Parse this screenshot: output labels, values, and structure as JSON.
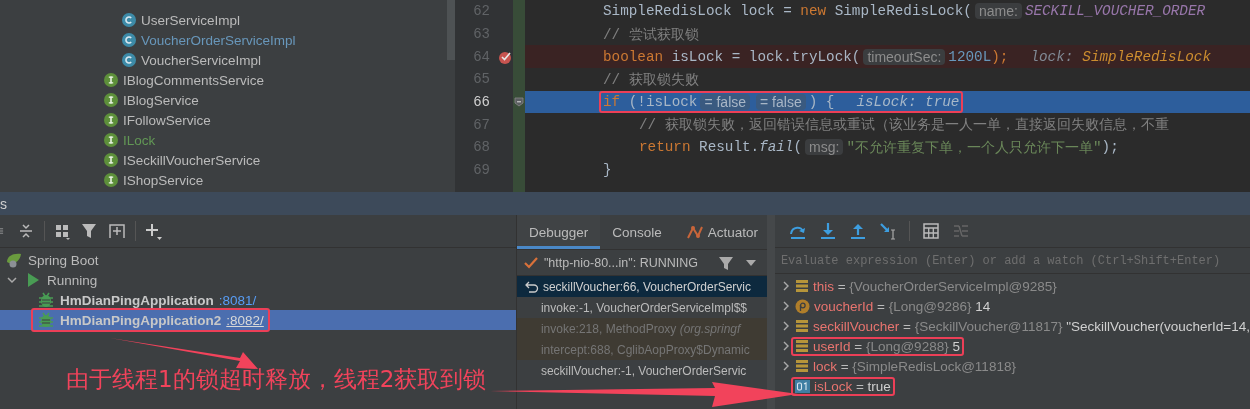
{
  "project_tree": {
    "items": [
      {
        "kind": "class",
        "label": "UserServiceImpl",
        "color": "#bbbbbb"
      },
      {
        "kind": "class",
        "label": "VoucherOrderServiceImpl",
        "color": "#6897bb"
      },
      {
        "kind": "class",
        "label": "VoucherServiceImpl",
        "color": "#bbbbbb"
      },
      {
        "kind": "interface",
        "label": "IBlogCommentsService",
        "color": "#bbbbbb"
      },
      {
        "kind": "interface",
        "label": "IBlogService",
        "color": "#bbbbbb"
      },
      {
        "kind": "interface",
        "label": "IFollowService",
        "color": "#bbbbbb"
      },
      {
        "kind": "interface",
        "label": "ILock",
        "color": "#629755"
      },
      {
        "kind": "interface",
        "label": "ISeckillVoucherService",
        "color": "#bbbbbb"
      },
      {
        "kind": "interface",
        "label": "IShopService",
        "color": "#bbbbbb"
      }
    ]
  },
  "editor": {
    "lines": [
      {
        "number": "62",
        "breakpoint": false,
        "current": false,
        "highlighted": false,
        "tokens": [
          {
            "kind": "plain",
            "text": "SimpleRedisLock lock = "
          },
          {
            "kind": "keyword",
            "text": "new"
          },
          {
            "kind": "plain",
            "text": " SimpleRedisLock("
          },
          {
            "kind": "hint",
            "text": "name:"
          },
          {
            "kind": "const",
            "text": "SECKILL_VOUCHER_ORDER"
          }
        ]
      },
      {
        "number": "63",
        "breakpoint": false,
        "current": false,
        "highlighted": false,
        "tokens": [
          {
            "kind": "comment",
            "text": "// 尝试获取锁"
          }
        ]
      },
      {
        "number": "64",
        "breakpoint": true,
        "current": false,
        "highlighted": false,
        "tokens": [
          {
            "kind": "keyword",
            "text": "boolean"
          },
          {
            "kind": "plain",
            "text": " isLock = lock.tryLock("
          },
          {
            "kind": "hint",
            "text": "timeoutSec:"
          },
          {
            "kind": "number",
            "text": "1200L"
          },
          {
            "kind": "keyword",
            "text": ");"
          },
          {
            "kind": "debug-label",
            "text": "lock:"
          },
          {
            "kind": "debug-value",
            "text": "SimpleRedisLock"
          }
        ]
      },
      {
        "number": "65",
        "breakpoint": false,
        "current": false,
        "highlighted": false,
        "tokens": [
          {
            "kind": "comment",
            "text": "// 获取锁失败"
          }
        ]
      },
      {
        "number": "66",
        "breakpoint": false,
        "current": true,
        "highlighted": true,
        "tokens": [
          {
            "kind": "keyword",
            "text": "if"
          },
          {
            "kind": "plain",
            "text": " (!isLock"
          },
          {
            "kind": "hint",
            "text": "= false"
          },
          {
            "kind": "hint",
            "text": "= false"
          },
          {
            "kind": "plain",
            "text": ") {"
          },
          {
            "kind": "debug-label",
            "text": "isLock: true"
          }
        ],
        "children": [
          {
            "number": "67",
            "breakpoint": false,
            "current": false,
            "highlighted": false,
            "tokens": [
              {
                "kind": "comment",
                "text": "// 获取锁失败，返回错误信息或重试（该业务是一人一单，直接返回失败信息，不重"
              }
            ]
          },
          {
            "number": "68",
            "breakpoint": false,
            "current": false,
            "highlighted": false,
            "tokens": [
              {
                "kind": "keyword",
                "text": "return"
              },
              {
                "kind": "plain",
                "text": " Result."
              },
              {
                "kind": "method",
                "text": "fail"
              },
              {
                "kind": "plain",
                "text": "("
              },
              {
                "kind": "hint",
                "text": "msg:"
              },
              {
                "kind": "string",
                "text": "\"不允许重复下单，一个人只允许下一单\""
              },
              {
                "kind": "plain",
                "text": ");"
              }
            ]
          }
        ]
      },
      {
        "number": "69",
        "breakpoint": false,
        "current": false,
        "highlighted": false,
        "tokens": [
          {
            "kind": "plain",
            "text": "}"
          }
        ]
      }
    ]
  },
  "services": {
    "title": "s",
    "tree": [
      {
        "kind": "group",
        "label": "Spring Boot",
        "children": [
          {
            "kind": "status",
            "label": "Running",
            "expanded": true,
            "children": [
              {
                "kind": "app",
                "label": "HmDianPingApplication",
                "port": ":8081/",
                "selected": false,
                "highlighted": false
              },
              {
                "kind": "app",
                "label": "HmDianPingApplication2",
                "port": ":8082/",
                "selected": true,
                "highlighted": true
              }
            ]
          }
        ]
      }
    ]
  },
  "debugger": {
    "tabs": [
      {
        "label": "Debugger",
        "selected": true
      },
      {
        "label": "Console",
        "selected": false
      },
      {
        "label": "Actuator",
        "selected": false
      }
    ],
    "thread": "\"http-nio-80...in\": RUNNING",
    "frames": [
      {
        "kind": "app",
        "text": "seckillVoucher:66, VoucherOrderServic",
        "selected": true
      },
      {
        "kind": "app",
        "text": "invoke:-1, VoucherOrderServiceImpl$$",
        "selected": false
      },
      {
        "kind": "library",
        "text": "invoke:218, MethodProxy *(org.springf*",
        "selected": false
      },
      {
        "kind": "library",
        "text": "intercept:688, CglibAopProxy$Dynamic",
        "selected": false
      },
      {
        "kind": "app",
        "text": "seckillVoucher:-1, VoucherOrderServic",
        "selected": false
      }
    ]
  },
  "variables": {
    "placeholder": "Evaluate expression (Enter) or add a watch (Ctrl+Shift+Enter)",
    "items": [
      {
        "kind": "field",
        "name": "this",
        "operator": "=",
        "value": "{VoucherOrderServiceImpl@9285}",
        "highlighted": false
      },
      {
        "kind": "param",
        "name": "voucherId",
        "operator": "=",
        "value": "{Long@9286}",
        "extra": "14",
        "highlighted": false
      },
      {
        "kind": "field",
        "name": "seckillVoucher",
        "operator": "=",
        "value": "{SeckillVoucher@11817}",
        "extra": "\"SeckillVoucher(voucherId=14,",
        "highlighted": false
      },
      {
        "kind": "field",
        "name": "userId",
        "operator": "=",
        "value": "{Long@9288}",
        "extra": "5",
        "highlighted": true
      },
      {
        "kind": "field",
        "name": "lock",
        "operator": "=",
        "value": "{SimpleRedisLock@11818}",
        "highlighted": false
      },
      {
        "kind": "primitive",
        "name": "isLock",
        "operator": "=",
        "value": "true",
        "highlighted": true
      }
    ]
  },
  "annotation": {
    "text": "由于线程1的锁超时释放，线程2获取到锁"
  }
}
